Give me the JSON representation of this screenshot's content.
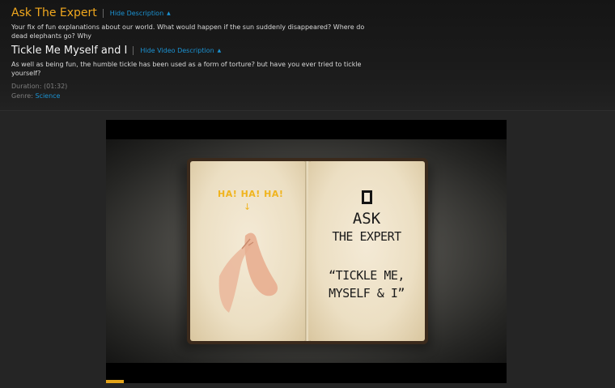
{
  "show": {
    "title": "Ask The Expert",
    "toggle_label": "Hide Description",
    "toggle_icon": "caret-up-icon",
    "description": "Your fix of fun explanations about our world. What would happen if the sun suddenly disappeared? Where do dead elephants go? Why"
  },
  "episode": {
    "title": "Tickle Me Myself and I",
    "toggle_label": "Hide Video Description",
    "toggle_icon": "caret-up-icon",
    "description": "As well as being fun, the humble tickle has been used as a form of torture? but have you ever tried to tickle yourself?",
    "duration_label": "Duration: (01:32)",
    "genre_label": "Genre:",
    "genre_value": "Science"
  },
  "video": {
    "left_page_text": "HA! HA! HA!",
    "right_page_line1": "ASK",
    "right_page_line2": "THE EXPERT",
    "right_page_line3": "“TICKLE ME,",
    "right_page_line4": "MYSELF & I”",
    "progress_fraction": 0.045
  },
  "colors": {
    "show_title": "#f1a81e",
    "link": "#1b93d3",
    "progress": "#e3a41a",
    "background": "#252525"
  }
}
